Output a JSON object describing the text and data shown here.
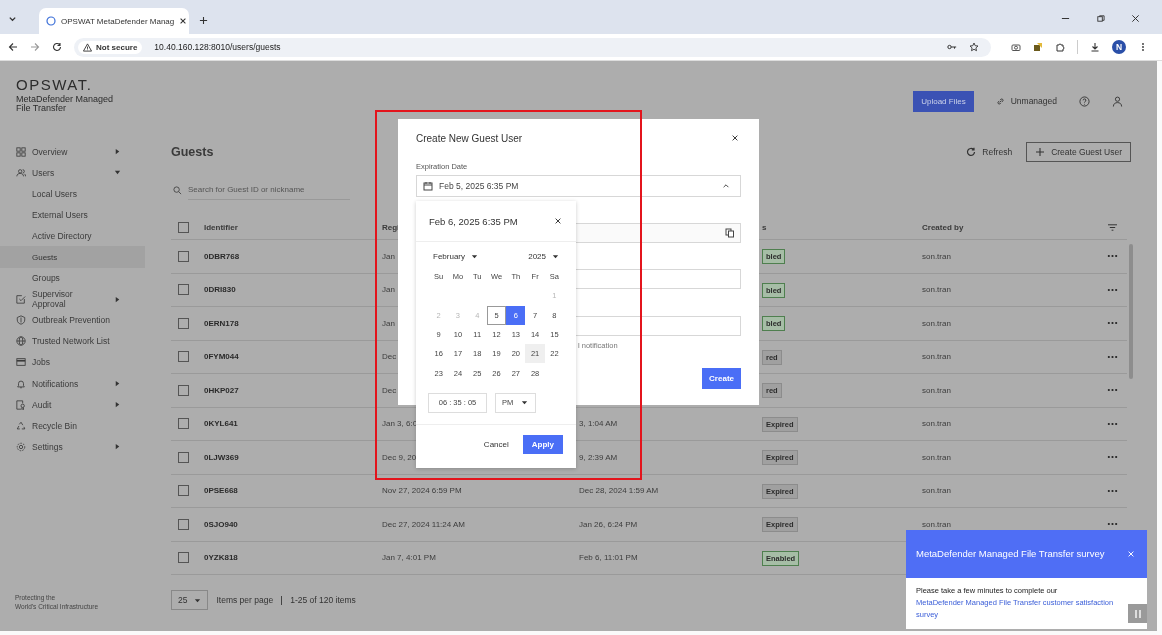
{
  "browser": {
    "tab_title": "OPSWAT MetaDefender Manag",
    "security": "Not secure",
    "url": "10.40.160.128:8010/users/guests",
    "profile": "N"
  },
  "header": {
    "logo": "OPSWAT.",
    "product_lines": [
      "MetaDefender Managed",
      "File Transfer"
    ],
    "upload_button": "Upload Files",
    "unmanaged": "Unmanaged"
  },
  "sidebar": {
    "items": [
      {
        "label": "Overview",
        "expandable": true,
        "expanded": false,
        "selected": false
      },
      {
        "label": "Users",
        "expandable": true,
        "expanded": true,
        "selected": false,
        "children": [
          {
            "label": "Local Users",
            "selected": false
          },
          {
            "label": "External Users",
            "selected": false
          },
          {
            "label": "Active Directory",
            "selected": false
          },
          {
            "label": "Guests",
            "selected": true
          },
          {
            "label": "Groups",
            "selected": false
          }
        ]
      },
      {
        "label": "Supervisor Approval",
        "expandable": true,
        "expanded": false,
        "selected": false
      },
      {
        "label": "Outbreak Prevention",
        "expandable": false,
        "selected": false
      },
      {
        "label": "Trusted Network List",
        "expandable": false,
        "selected": false
      },
      {
        "label": "Jobs",
        "expandable": false,
        "selected": false
      },
      {
        "label": "Notifications",
        "expandable": true,
        "expanded": false,
        "selected": false
      },
      {
        "label": "Audit",
        "expandable": true,
        "expanded": false,
        "selected": false
      },
      {
        "label": "Recycle Bin",
        "expandable": false,
        "selected": false
      },
      {
        "label": "Settings",
        "expandable": true,
        "expanded": false,
        "selected": false
      }
    ],
    "footer_lines": [
      "Protecting the",
      "World's Critical Infrastructure"
    ]
  },
  "page": {
    "title": "Guests",
    "refresh": "Refresh",
    "create_button": "Create Guest User",
    "search": {
      "placeholder": "Search for Guest ID or nickname"
    }
  },
  "table": {
    "select_all_checked": false,
    "columns": {
      "identifier": "Identifier",
      "column_2": "Regi",
      "column_4": "s",
      "created_by": "Created by"
    },
    "rows": [
      {
        "checked": false,
        "identifier": "0DBR768",
        "column_2": "Jan",
        "status": {
          "text": "bled",
          "kind": "enabled"
        },
        "created_by": "son.tran"
      },
      {
        "checked": false,
        "identifier": "0DRI830",
        "column_2": "Jan",
        "status": {
          "text": "bled",
          "kind": "enabled"
        },
        "created_by": "son.tran"
      },
      {
        "checked": false,
        "identifier": "0ERN178",
        "column_2": "Jan",
        "status": {
          "text": "bled",
          "kind": "enabled"
        },
        "created_by": "son.tran"
      },
      {
        "checked": false,
        "identifier": "0FYM044",
        "column_2": "Dec",
        "status": {
          "text": "red",
          "kind": "expired"
        },
        "created_by": "son.tran"
      },
      {
        "checked": false,
        "identifier": "0HKP027",
        "column_2": "Dec",
        "status": {
          "text": "red",
          "kind": "expired"
        },
        "created_by": "son.tran"
      },
      {
        "checked": false,
        "identifier": "0KYL641",
        "column_2": "Jan 3, 6:0",
        "column_3": "3, 1:04 AM",
        "status": {
          "text": "Expired",
          "kind": "expired"
        },
        "created_by": "son.tran"
      },
      {
        "checked": false,
        "identifier": "0LJW369",
        "column_2": "Dec 9, 20",
        "column_3": "9, 2:39 AM",
        "status": {
          "text": "Expired",
          "kind": "expired"
        },
        "created_by": "son.tran"
      },
      {
        "checked": false,
        "identifier": "0PSE668",
        "column_2": "Nov 27, 2024 6:59 PM",
        "column_3": "Dec 28, 2024 1:59 AM",
        "status": {
          "text": "Expired",
          "kind": "expired"
        },
        "created_by": "son.tran"
      },
      {
        "checked": false,
        "identifier": "0SJO940",
        "column_2": "Dec 27, 2024 11:24 AM",
        "column_3": "Jan 26, 6:24 PM",
        "status": {
          "text": "Expired",
          "kind": "expired"
        },
        "created_by": "son.tran"
      },
      {
        "checked": false,
        "identifier": "0YZK818",
        "column_2": "Jan 7, 4:01 PM",
        "column_3": "Feb 6, 11:01 PM",
        "status": {
          "text": "Enabled",
          "kind": "enabled"
        }
      }
    ]
  },
  "pagination": {
    "page_size": "25",
    "items_per_page": "Items per page",
    "range": "1-25 of 120 items"
  },
  "dialog": {
    "title": "Create New Guest User",
    "expiration_label": "Expiration Date",
    "expiration_value": "Feb 5, 2025 6:35 PM",
    "notification_fragment": "l notification",
    "create_button": "Create"
  },
  "date_picker": {
    "title": "Feb 6, 2025 6:35 PM",
    "month": "February",
    "year": "2025",
    "weekdays": [
      "Su",
      "Mo",
      "Tu",
      "We",
      "Th",
      "Fr",
      "Sa"
    ],
    "weeks": [
      [
        {
          "kind": "blank"
        },
        {
          "kind": "blank"
        },
        {
          "kind": "blank"
        },
        {
          "kind": "blank"
        },
        {
          "kind": "blank"
        },
        {
          "kind": "blank"
        },
        {
          "kind": "day",
          "day": "1",
          "disabled": true,
          "selected": false,
          "current": false,
          "hovered": false
        }
      ],
      [
        {
          "kind": "day",
          "day": "2",
          "disabled": true,
          "selected": false,
          "current": false,
          "hovered": false
        },
        {
          "kind": "day",
          "day": "3",
          "disabled": true,
          "selected": false,
          "current": false,
          "hovered": false
        },
        {
          "kind": "day",
          "day": "4",
          "disabled": true,
          "selected": false,
          "current": false,
          "hovered": false
        },
        {
          "kind": "day",
          "day": "5",
          "disabled": false,
          "selected": false,
          "current": true,
          "hovered": false
        },
        {
          "kind": "day",
          "day": "6",
          "disabled": false,
          "selected": true,
          "current": false,
          "hovered": false
        },
        {
          "kind": "day",
          "day": "7",
          "disabled": false,
          "selected": false,
          "current": false,
          "hovered": false
        },
        {
          "kind": "day",
          "day": "8",
          "disabled": false,
          "selected": false,
          "current": false,
          "hovered": false
        }
      ],
      [
        {
          "kind": "day",
          "day": "9",
          "disabled": false,
          "selected": false,
          "current": false,
          "hovered": false
        },
        {
          "kind": "day",
          "day": "10",
          "disabled": false,
          "selected": false,
          "current": false,
          "hovered": false
        },
        {
          "kind": "day",
          "day": "11",
          "disabled": false,
          "selected": false,
          "current": false,
          "hovered": false
        },
        {
          "kind": "day",
          "day": "12",
          "disabled": false,
          "selected": false,
          "current": false,
          "hovered": false
        },
        {
          "kind": "day",
          "day": "13",
          "disabled": false,
          "selected": false,
          "current": false,
          "hovered": false
        },
        {
          "kind": "day",
          "day": "14",
          "disabled": false,
          "selected": false,
          "current": false,
          "hovered": false
        },
        {
          "kind": "day",
          "day": "15",
          "disabled": false,
          "selected": false,
          "current": false,
          "hovered": false
        }
      ],
      [
        {
          "kind": "day",
          "day": "16",
          "disabled": false,
          "selected": false,
          "current": false,
          "hovered": false
        },
        {
          "kind": "day",
          "day": "17",
          "disabled": false,
          "selected": false,
          "current": false,
          "hovered": false
        },
        {
          "kind": "day",
          "day": "18",
          "disabled": false,
          "selected": false,
          "current": false,
          "hovered": false
        },
        {
          "kind": "day",
          "day": "19",
          "disabled": false,
          "selected": false,
          "current": false,
          "hovered": false
        },
        {
          "kind": "day",
          "day": "20",
          "disabled": false,
          "selected": false,
          "current": false,
          "hovered": false
        },
        {
          "kind": "day",
          "day": "21",
          "disabled": false,
          "selected": false,
          "current": false,
          "hovered": true
        },
        {
          "kind": "day",
          "day": "22",
          "disabled": false,
          "selected": false,
          "current": false,
          "hovered": false
        }
      ],
      [
        {
          "kind": "day",
          "day": "23",
          "disabled": false,
          "selected": false,
          "current": false,
          "hovered": false
        },
        {
          "kind": "day",
          "day": "24",
          "disabled": false,
          "selected": false,
          "current": false,
          "hovered": false
        },
        {
          "kind": "day",
          "day": "25",
          "disabled": false,
          "selected": false,
          "current": false,
          "hovered": false
        },
        {
          "kind": "day",
          "day": "26",
          "disabled": false,
          "selected": false,
          "current": false,
          "hovered": false
        },
        {
          "kind": "day",
          "day": "27",
          "disabled": false,
          "selected": false,
          "current": false,
          "hovered": false
        },
        {
          "kind": "day",
          "day": "28",
          "disabled": false,
          "selected": false,
          "current": false,
          "hovered": false
        }
      ]
    ],
    "time": "06 : 35 : 05",
    "period": "PM",
    "cancel": "Cancel",
    "apply": "Apply"
  },
  "toast": {
    "title": "MetaDefender Managed File Transfer survey",
    "message": "Please take a few minutes to complete our",
    "link": "MetaDefender Managed File Transfer customer satisfaction survey"
  }
}
